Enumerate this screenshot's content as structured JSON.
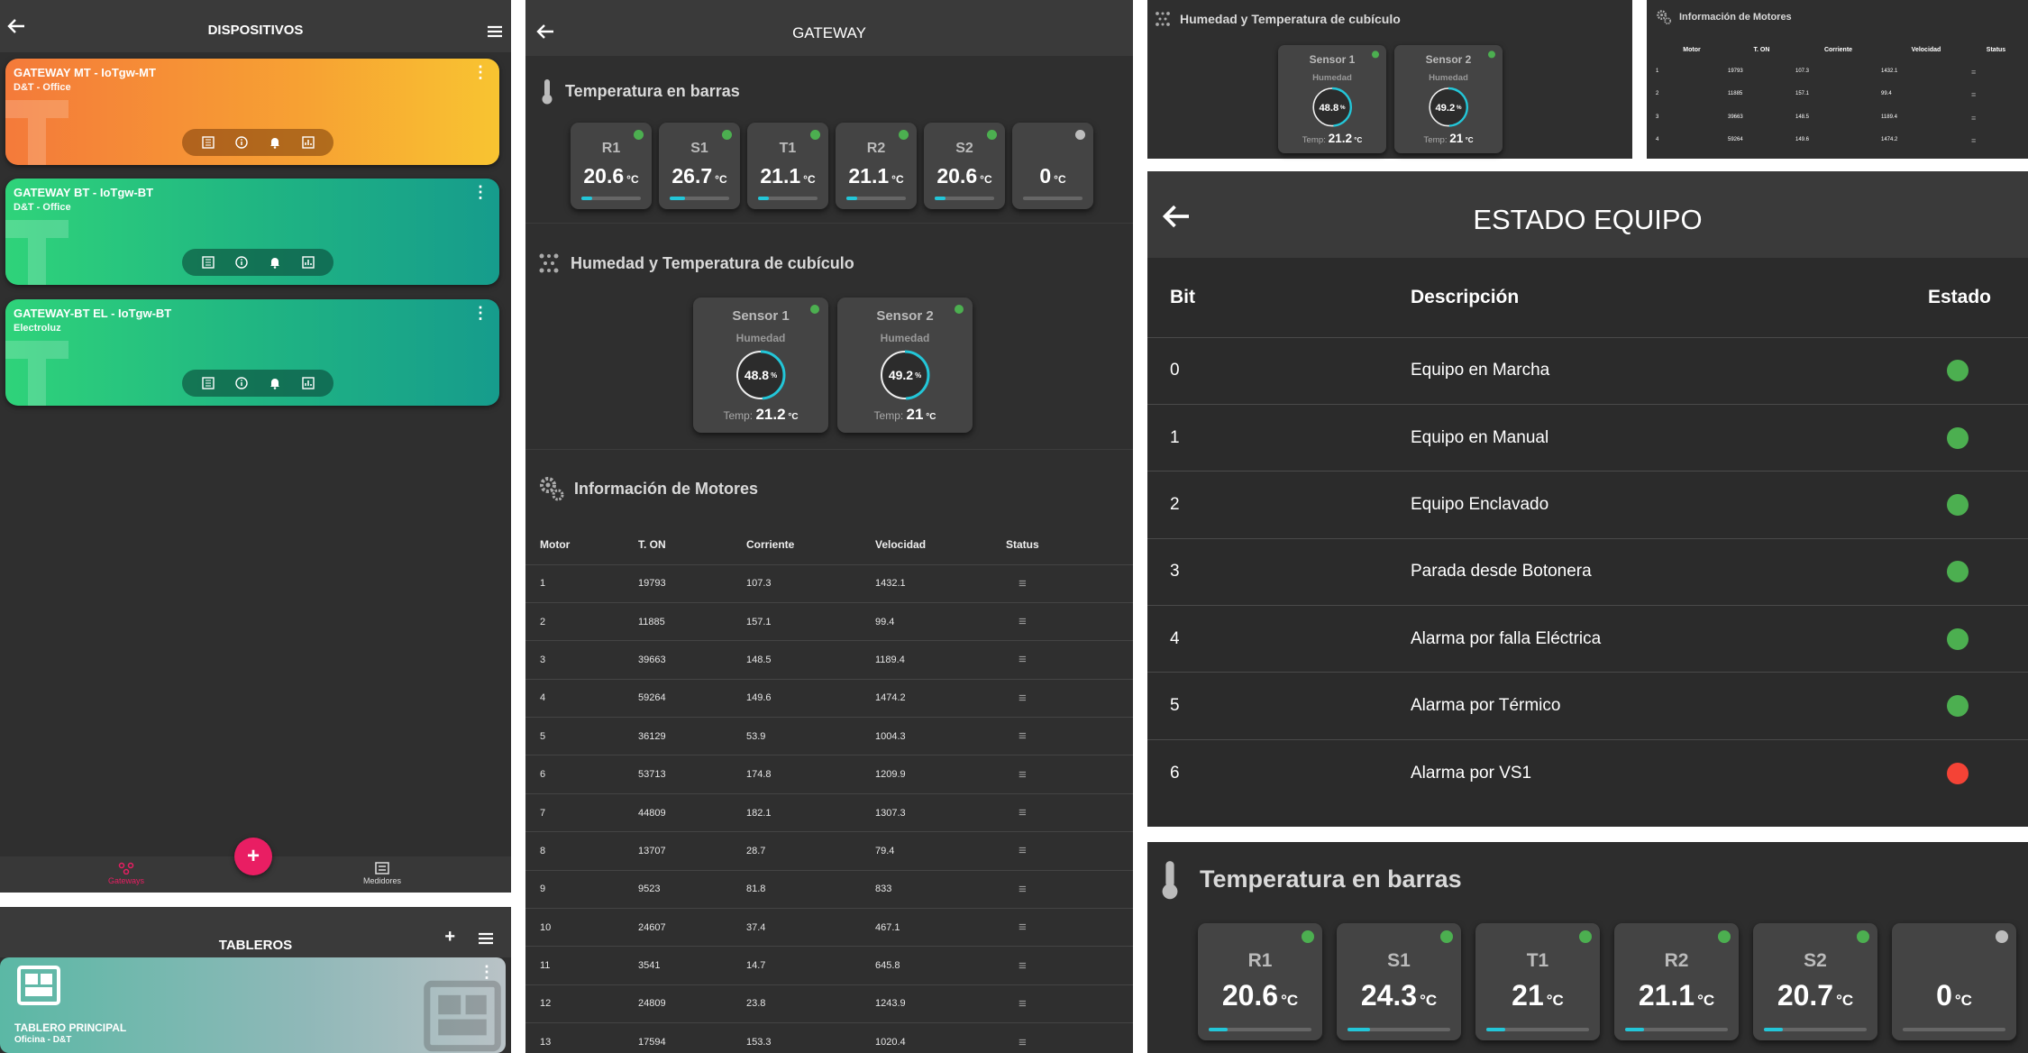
{
  "panel1": {
    "title": "DISPOSITIVOS",
    "cards": [
      {
        "title": "GATEWAY MT - IoTgw-MT",
        "subtitle": "D&T - Office"
      },
      {
        "title": "GATEWAY BT - IoTgw-BT",
        "subtitle": "D&T - Office"
      },
      {
        "title": "GATEWAY-BT EL - IoTgw-BT",
        "subtitle": "Electroluz"
      }
    ],
    "nav": {
      "gateways": "Gateways",
      "medidores": "Medidores"
    },
    "fab": "+"
  },
  "panel2": {
    "title": "TABLEROS",
    "card_title": "TABLERO PRINCIPAL",
    "card_subtitle": "Oficina - D&T"
  },
  "gateway": {
    "title": "GATEWAY",
    "sec_temp": "Temperatura en barras",
    "sec_hum": "Humedad y Temperatura de cubículo",
    "sec_mot": "Información de Motores",
    "unit_c": "°C",
    "chips": [
      {
        "label": "R1",
        "value": "20.6",
        "status": "on",
        "level": 0.18
      },
      {
        "label": "S1",
        "value": "26.7",
        "status": "on",
        "level": 0.25
      },
      {
        "label": "T1",
        "value": "21.1",
        "status": "on",
        "level": 0.18
      },
      {
        "label": "R2",
        "value": "21.1",
        "status": "on",
        "level": 0.18
      },
      {
        "label": "S2",
        "value": "20.6",
        "status": "on",
        "level": 0.18
      },
      {
        "label": "",
        "value": "0",
        "status": "off",
        "level": 0
      }
    ],
    "sensors": [
      {
        "name": "Sensor 1",
        "hum_label": "Humedad",
        "hum": "48.8",
        "temp_label": "Temp:",
        "temp": "21.2"
      },
      {
        "name": "Sensor 2",
        "hum_label": "Humedad",
        "hum": "49.2",
        "temp_label": "Temp:",
        "temp": "21"
      }
    ],
    "motor_headers": [
      "Motor",
      "T. ON",
      "Corriente",
      "Velocidad",
      "Status"
    ],
    "motors": [
      [
        "1",
        "19793",
        "107.3",
        "1432.1"
      ],
      [
        "2",
        "11885",
        "157.1",
        "99.4"
      ],
      [
        "3",
        "39663",
        "148.5",
        "1189.4"
      ],
      [
        "4",
        "59264",
        "149.6",
        "1474.2"
      ],
      [
        "5",
        "36129",
        "53.9",
        "1004.3"
      ],
      [
        "6",
        "53713",
        "174.8",
        "1209.9"
      ],
      [
        "7",
        "44809",
        "182.1",
        "1307.3"
      ],
      [
        "8",
        "13707",
        "28.7",
        "79.4"
      ],
      [
        "9",
        "9523",
        "81.8",
        "833"
      ],
      [
        "10",
        "24607",
        "37.4",
        "467.1"
      ],
      [
        "11",
        "3541",
        "14.7",
        "645.8"
      ],
      [
        "12",
        "24809",
        "23.8",
        "1243.9"
      ],
      [
        "13",
        "17594",
        "153.3",
        "1020.4"
      ]
    ]
  },
  "mini_hum": {
    "title": "Humedad y Temperatura de cubículo",
    "sensors": [
      {
        "name": "Sensor 1",
        "hum_label": "Humedad",
        "hum": "48.8",
        "temp_label": "Temp:",
        "temp": "21.2"
      },
      {
        "name": "Sensor 2",
        "hum_label": "Humedad",
        "hum": "49.2",
        "temp_label": "Temp:",
        "temp": "21"
      }
    ]
  },
  "mini_mot": {
    "title": "Información de Motores",
    "headers": [
      "Motor",
      "T. ON",
      "Corriente",
      "Velocidad",
      "Status"
    ],
    "rows": [
      [
        "1",
        "19793",
        "107.3",
        "1432.1"
      ],
      [
        "2",
        "11885",
        "157.1",
        "99.4"
      ],
      [
        "3",
        "39663",
        "148.5",
        "1189.4"
      ],
      [
        "4",
        "59264",
        "149.6",
        "1474.2"
      ]
    ]
  },
  "estado": {
    "title": "ESTADO EQUIPO",
    "headers": [
      "Bit",
      "Descripción",
      "Estado"
    ],
    "rows": [
      {
        "bit": "0",
        "desc": "Equipo en Marcha",
        "state": "ok"
      },
      {
        "bit": "1",
        "desc": "Equipo en Manual",
        "state": "ok"
      },
      {
        "bit": "2",
        "desc": "Equipo Enclavado",
        "state": "ok"
      },
      {
        "bit": "3",
        "desc": "Parada desde Botonera",
        "state": "ok"
      },
      {
        "bit": "4",
        "desc": "Alarma por falla Eléctrica",
        "state": "ok"
      },
      {
        "bit": "5",
        "desc": "Alarma por Térmico",
        "state": "ok"
      },
      {
        "bit": "6",
        "desc": "Alarma por VS1",
        "state": "alarm"
      }
    ]
  },
  "bars_large": {
    "title": "Temperatura en barras",
    "unit": "°C",
    "chips": [
      {
        "label": "R1",
        "value": "20.6",
        "status": "on",
        "level": 0.18
      },
      {
        "label": "S1",
        "value": "24.3",
        "status": "on",
        "level": 0.22
      },
      {
        "label": "T1",
        "value": "21",
        "status": "on",
        "level": 0.18
      },
      {
        "label": "R2",
        "value": "21.1",
        "status": "on",
        "level": 0.18
      },
      {
        "label": "S2",
        "value": "20.7",
        "status": "on",
        "level": 0.18
      },
      {
        "label": "",
        "value": "0",
        "status": "off",
        "level": 0
      }
    ]
  },
  "colors": {
    "ok": "#4caf50",
    "alarm": "#f44336",
    "off": "#bdbdbd",
    "accent": "#23c6d8",
    "fab": "#e91e63"
  }
}
